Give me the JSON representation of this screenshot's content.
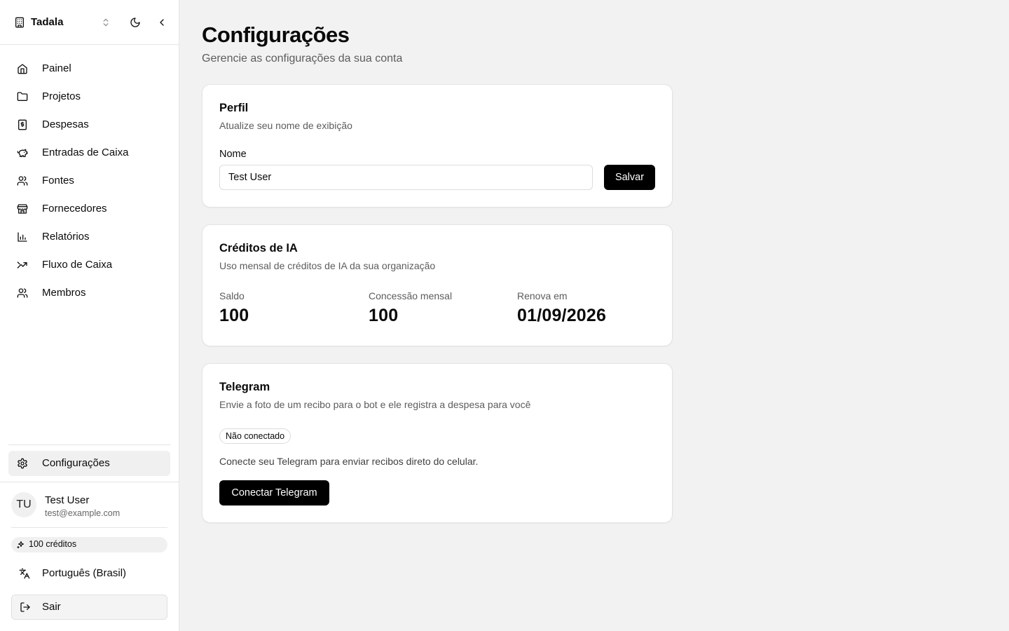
{
  "sidebar": {
    "org_name": "Tadala",
    "nav": [
      {
        "label": "Painel",
        "icon": "home-icon"
      },
      {
        "label": "Projetos",
        "icon": "folder-icon"
      },
      {
        "label": "Despesas",
        "icon": "receipt-icon"
      },
      {
        "label": "Entradas de Caixa",
        "icon": "piggy-bank-icon"
      },
      {
        "label": "Fontes",
        "icon": "users-icon"
      },
      {
        "label": "Fornecedores",
        "icon": "store-icon"
      },
      {
        "label": "Relatórios",
        "icon": "bar-chart-icon"
      },
      {
        "label": "Fluxo de Caixa",
        "icon": "trend-icon"
      },
      {
        "label": "Membros",
        "icon": "users-icon"
      }
    ],
    "settings_label": "Configurações",
    "user": {
      "initials": "TU",
      "name": "Test User",
      "email": "test@example.com"
    },
    "credits_label": "100 créditos",
    "language_label": "Português (Brasil)",
    "logout_label": "Sair"
  },
  "page": {
    "title": "Configurações",
    "subtitle": "Gerencie as configurações da sua conta"
  },
  "profile": {
    "title": "Perfil",
    "description": "Atualize seu nome de exibição",
    "name_label": "Nome",
    "name_value": "Test User",
    "save_label": "Salvar"
  },
  "ai_credits": {
    "title": "Créditos de IA",
    "description": "Uso mensal de créditos de IA da sua organização",
    "stats": [
      {
        "label": "Saldo",
        "value": "100"
      },
      {
        "label": "Concessão mensal",
        "value": "100"
      },
      {
        "label": "Renova em",
        "value": "01/09/2026"
      }
    ]
  },
  "telegram": {
    "title": "Telegram",
    "description": "Envie a foto de um recibo para o bot e ele registra a despesa para você",
    "status": "Não conectado",
    "info": "Conecte seu Telegram para enviar recibos direto do celular.",
    "connect_label": "Conectar Telegram"
  },
  "colors": {
    "background": "#f2f2f2",
    "primary_button": "#000000",
    "sidebar": "#ffffff"
  }
}
